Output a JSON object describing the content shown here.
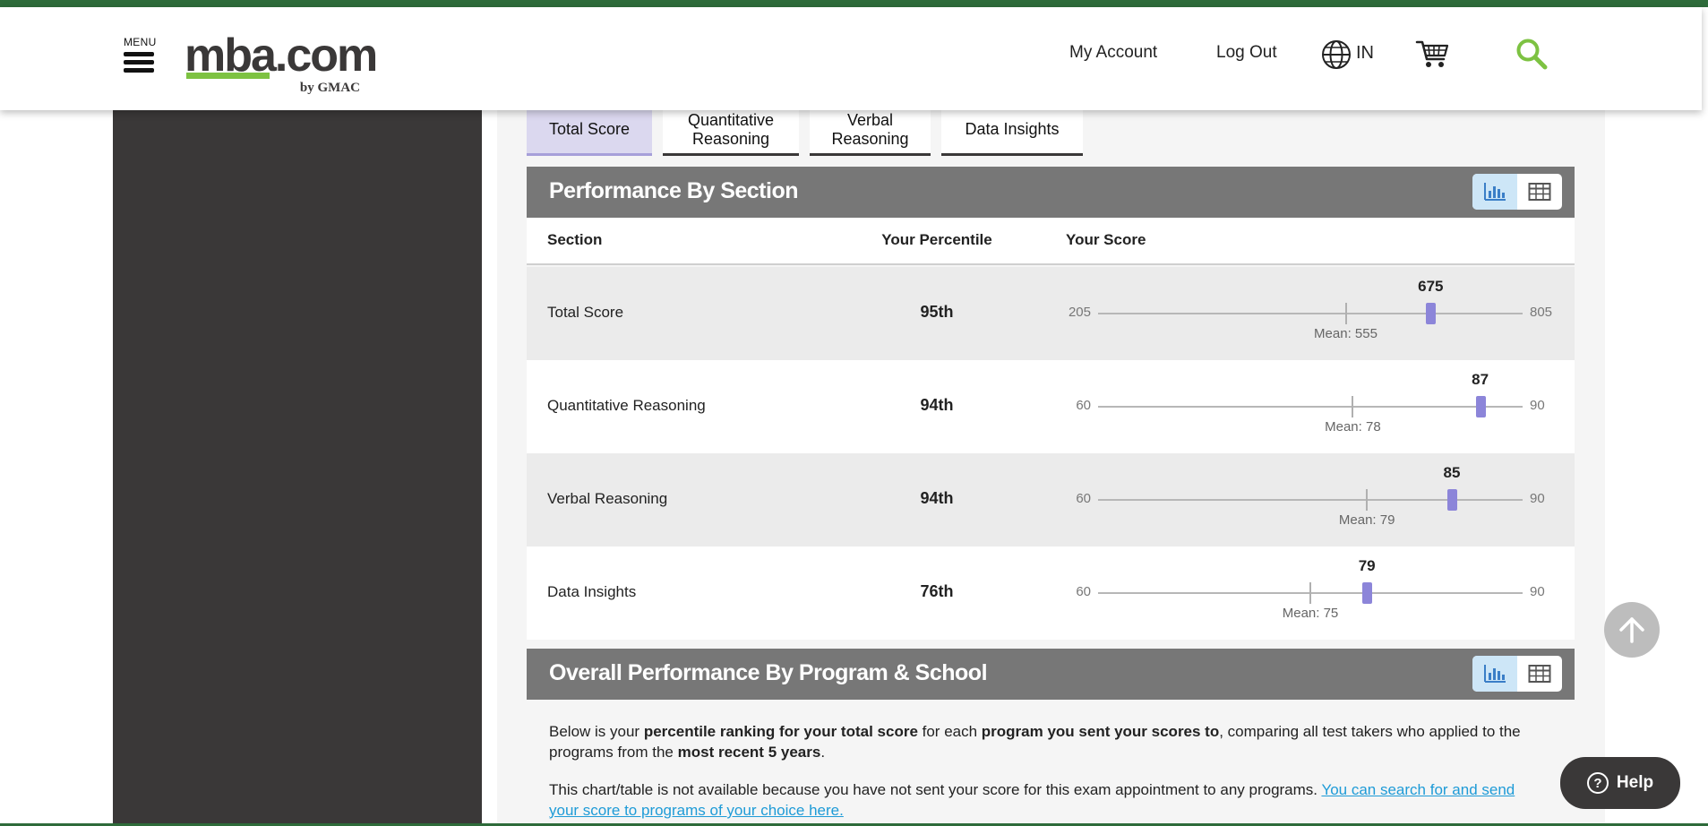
{
  "header": {
    "menu_label": "MENU",
    "logo_main": "mba.com",
    "logo_sub": "by GMAC",
    "my_account": "My Account",
    "log_out": "Log Out",
    "language": "IN",
    "icons": [
      "hamburger-menu-icon",
      "globe-icon",
      "cart-icon",
      "search-icon"
    ],
    "accent_color": "#7dc242"
  },
  "tabs": [
    {
      "label": "Total Score",
      "active": true
    },
    {
      "label": "Quantitative Reasoning",
      "active": false
    },
    {
      "label": "Verbal Reasoning",
      "active": false
    },
    {
      "label": "Data Insights",
      "active": false
    }
  ],
  "performance_by_section": {
    "title": "Performance By Section",
    "view_toggle": [
      "bar-chart-icon",
      "table-icon"
    ],
    "columns": {
      "section": "Section",
      "percentile": "Your Percentile",
      "score": "Your Score"
    },
    "rows": [
      {
        "section": "Total Score",
        "percentile": "95th",
        "min": "205",
        "max": "805",
        "score": "675",
        "mean_label": "Mean: 555",
        "min_value": 205,
        "max_value": 805,
        "score_value": 675,
        "mean_value": 555
      },
      {
        "section": "Quantitative Reasoning",
        "percentile": "94th",
        "min": "60",
        "max": "90",
        "score": "87",
        "mean_label": "Mean: 78",
        "min_value": 60,
        "max_value": 90,
        "score_value": 87,
        "mean_value": 78
      },
      {
        "section": "Verbal Reasoning",
        "percentile": "94th",
        "min": "60",
        "max": "90",
        "score": "85",
        "mean_label": "Mean: 79",
        "min_value": 60,
        "max_value": 90,
        "score_value": 85,
        "mean_value": 79
      },
      {
        "section": "Data Insights",
        "percentile": "76th",
        "min": "60",
        "max": "90",
        "score": "79",
        "mean_label": "Mean: 75",
        "min_value": 60,
        "max_value": 90,
        "score_value": 79,
        "mean_value": 75
      }
    ],
    "marker_color": "#8c85d9"
  },
  "program_section": {
    "title": "Overall Performance By Program & School",
    "intro_1": "Below is your ",
    "intro_b1": "percentile ranking for your total score",
    "intro_2": " for each ",
    "intro_b2": "program you sent your scores to",
    "intro_3": ", comparing all test takers who applied to the programs from the ",
    "intro_b3": "most recent 5 years",
    "intro_4": ".",
    "unavailable": "This chart/table is not available because you have not sent your score for this exam appointment to any programs. ",
    "link": "You can search for and send your score to programs of your choice here."
  },
  "help_label": "Help"
}
